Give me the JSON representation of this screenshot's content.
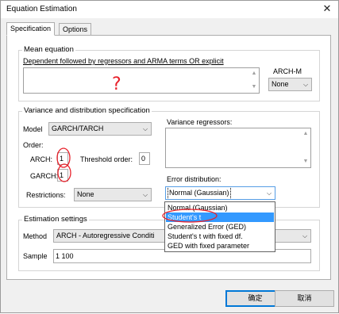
{
  "window": {
    "title": "Equation Estimation",
    "close_glyph": "✕"
  },
  "tabs": [
    {
      "label": "Specification"
    },
    {
      "label": "Options"
    }
  ],
  "mean_equation": {
    "group_label": "Mean equation",
    "description": "Dependent followed by regressors and ARMA terms OR explicit",
    "arch_m_label": "ARCH-M",
    "arch_m_value": "None"
  },
  "variance": {
    "group_label": "Variance and distribution specification",
    "model_label": "Model",
    "model_value": "GARCH/TARCH",
    "order_label": "Order:",
    "arch_label": "ARCH:",
    "arch_value": "1",
    "threshold_label": "Threshold order:",
    "threshold_value": "0",
    "garch_label": "GARCH:",
    "garch_value": "1",
    "restrictions_label": "Restrictions:",
    "restrictions_value": "None",
    "regressors_label": "Variance regressors:",
    "error_dist_label": "Error distribution:",
    "error_dist_value": "Normal (Gaussian)",
    "error_dist_options": [
      "Normal (Gaussian)",
      "Student's t",
      "Generalized Error (GED)",
      "Student's t with fixed df.",
      "GED with fixed parameter"
    ]
  },
  "estimation": {
    "group_label": "Estimation settings",
    "method_label": "Method",
    "method_value": "ARCH  -  Autoregressive Conditi",
    "sample_label": "Sample",
    "sample_value": "1 100"
  },
  "buttons": {
    "ok_label": "确定",
    "cancel_label": "取消"
  },
  "annotations": {
    "question_mark": "?",
    "color": "#e8202a"
  },
  "colors": {
    "selection": "#3399ff",
    "focus_border": "#569de5",
    "default_button": "#0078d7"
  }
}
